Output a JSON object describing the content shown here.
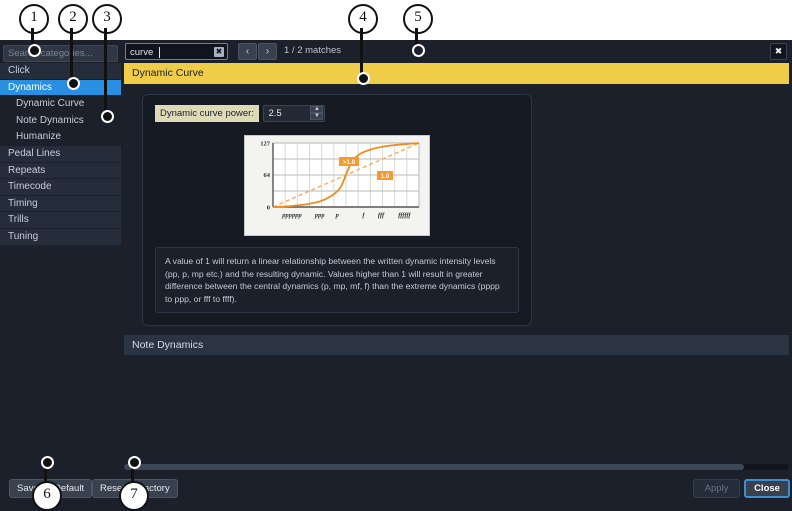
{
  "window": {
    "close_icon": "close-icon",
    "close_glyph": "✖"
  },
  "sidebar": {
    "search": {
      "placeholder": "Search categories...",
      "value": ""
    },
    "items": [
      {
        "label": "Click",
        "level": 0,
        "selected": false
      },
      {
        "label": "Dynamics",
        "level": 0,
        "selected": true
      },
      {
        "label": "Dynamic Curve",
        "level": 1,
        "selected": false
      },
      {
        "label": "Note Dynamics",
        "level": 1,
        "selected": false
      },
      {
        "label": "Humanize",
        "level": 1,
        "selected": false
      },
      {
        "label": "Pedal Lines",
        "level": 0,
        "selected": false
      },
      {
        "label": "Repeats",
        "level": 0,
        "selected": false
      },
      {
        "label": "Timecode",
        "level": 0,
        "selected": false
      },
      {
        "label": "Timing",
        "level": 0,
        "selected": false
      },
      {
        "label": "Trills",
        "level": 0,
        "selected": false
      },
      {
        "label": "Tuning",
        "level": 0,
        "selected": false
      }
    ]
  },
  "toolbar": {
    "find_value": "curve",
    "find_clear_glyph": "✖",
    "prev_glyph": "‹",
    "next_glyph": "›",
    "matches": "1 / 2 matches"
  },
  "sections": {
    "highlighted_title": "Dynamic Curve",
    "plain_title": "Note Dynamics"
  },
  "setting": {
    "label": "Dynamic curve power:",
    "value": "2.5",
    "up_glyph": "▲",
    "down_glyph": "▼"
  },
  "description": "A value of 1 will return a linear relationship between the written dynamic intensity levels (pp, p, mp etc.) and the resulting dynamic. Values higher than 1 will result in greater difference between the central dynamics (p, mp, mf, f) than the extreme dynamics (pppp to ppp, or fff to ffff).",
  "footer": {
    "save_as_default": "Save as Default",
    "reset_to_factory": "Reset to Factory",
    "apply": "Apply",
    "close": "Close"
  },
  "callouts": [
    {
      "number": "1"
    },
    {
      "number": "2"
    },
    {
      "number": "3"
    },
    {
      "number": "4"
    },
    {
      "number": "5"
    },
    {
      "number": "6"
    },
    {
      "number": "7"
    }
  ],
  "chart_data": {
    "type": "line",
    "title": "",
    "xlabel": "",
    "ylabel": "",
    "ylim": [
      0,
      127
    ],
    "ytick_labels": [
      "127",
      "64",
      "0"
    ],
    "ytick_values": [
      127,
      64,
      0
    ],
    "xtick_labels": [
      "pppppp",
      "ppp",
      "p",
      "f",
      "fff",
      "ffffff"
    ],
    "grid": true,
    "legend_position": "inline-annotations",
    "annotations": [
      {
        "text": ">1.0",
        "series": "curved",
        "color": "#f39322"
      },
      {
        "text": "1.0",
        "series": "linear",
        "color": "#f39322"
      }
    ],
    "series": [
      {
        "name": ">1.0",
        "style": "solid",
        "color": "#ef8c1f",
        "x": [
          0,
          0.08,
          0.16,
          0.24,
          0.32,
          0.4,
          0.46,
          0.5,
          0.54,
          0.6,
          0.68,
          0.76,
          0.84,
          0.92,
          1.0
        ],
        "y": [
          0,
          1,
          3,
          6,
          11,
          22,
          38,
          64,
          90,
          106,
          115,
          120,
          123,
          125,
          127
        ]
      },
      {
        "name": "1.0",
        "style": "dashed",
        "color": "#f6ab5a",
        "x": [
          0,
          1
        ],
        "y": [
          0,
          127
        ]
      }
    ]
  }
}
